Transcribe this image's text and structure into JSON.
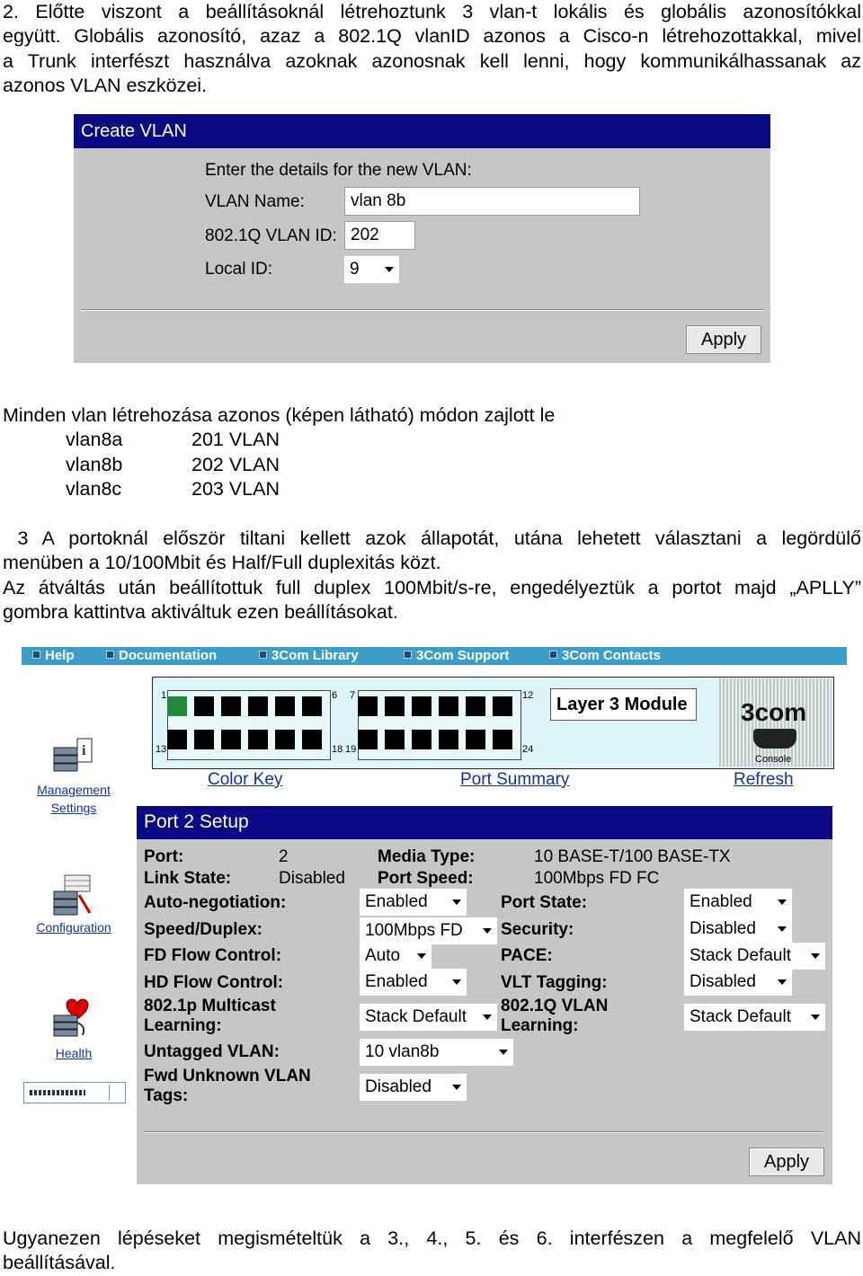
{
  "para1": {
    "lines": [
      "2. Előtte viszont a beállításoknál létrehoztunk 3 vlan-t lokális és globális azonosítókkal",
      "együtt. Globális azonosító, azaz a 802.1Q vlanID azonos a Cisco-n létrehozottakkal, mivel",
      "a Trunk interfészt használva azoknak azonosnak kell lenni, hogy kommunikálhassanak az",
      "azonos VLAN eszközei."
    ]
  },
  "create_vlan": {
    "title": "Create VLAN",
    "prompt": "Enter the details for the new VLAN:",
    "name_label": "VLAN Name:",
    "name_value": "vlan 8b",
    "id_label": "802.1Q VLAN ID:",
    "id_value": "202",
    "local_label": "Local ID:",
    "local_value": "9",
    "apply": "Apply"
  },
  "para2": {
    "intro": "Minden vlan létrehozása azonos (képen látható) módon zajlott le",
    "vlans": [
      {
        "name": "vlan8a",
        "id": "201 VLAN"
      },
      {
        "name": "vlan8b",
        "id": "202 VLAN"
      },
      {
        "name": "vlan8c",
        "id": "203 VLAN"
      }
    ]
  },
  "para3": {
    "lines": [
      " 3 A portoknál először tiltani kellett azok állapotát, utána lehetett választani a legördülő",
      "menüben a 10/100Mbit és Half/Full duplexitás közt.",
      "Az átváltás után beállítottuk full duplex 100Mbit/s-re, engedélyeztük a portot majd „APLLY”",
      "gombra kattintva aktiváltuk ezen beállításokat."
    ]
  },
  "menu": [
    "Help",
    "Documentation",
    "3Com Library",
    "3Com Support",
    "3Com Contacts"
  ],
  "switch": {
    "port_numbers": [
      "1",
      "6",
      "7",
      "12",
      "13",
      "18",
      "19",
      "24"
    ],
    "module_label": "Layer 3 Module",
    "logo": "3com",
    "console": "Console"
  },
  "links": {
    "color_key": "Color Key",
    "port_summary": "Port Summary",
    "refresh": "Refresh"
  },
  "sidebar": [
    {
      "label1": "Management",
      "label2": "Settings"
    },
    {
      "label1": "Configuration",
      "label2": ""
    },
    {
      "label1": "Health",
      "label2": ""
    }
  ],
  "port_setup": {
    "title": "Port 2 Setup",
    "port_label": "Port:",
    "port_value": "2",
    "link_label": "Link State:",
    "link_value": "Disabled",
    "media_label": "Media Type:",
    "media_value": "10 BASE-T/100 BASE-TX",
    "speed_label": "Port Speed:",
    "speed_value": "100Mbps FD FC",
    "autoneg_label": "Auto-negotiation:",
    "autoneg_value": "Enabled",
    "duplex_label": "Speed/Duplex:",
    "duplex_value": "100Mbps FD",
    "fdflow_label": "FD Flow Control:",
    "fdflow_value": "Auto",
    "hdflow_label": "HD Flow Control:",
    "hdflow_value": "Enabled",
    "mcast_label1": "802.1p Multicast",
    "mcast_label2": "Learning:",
    "mcast_value": "Stack Default",
    "untagged_label": "Untagged VLAN:",
    "untagged_value": "10 vlan8b",
    "fwd_label1": "Fwd Unknown VLAN",
    "fwd_label2": "Tags:",
    "fwd_value": "Disabled",
    "portstate_label": "Port State:",
    "portstate_value": "Enabled",
    "security_label": "Security:",
    "security_value": "Disabled",
    "pace_label": "PACE:",
    "pace_value": "Stack Default",
    "vlt_label": "VLT Tagging:",
    "vlt_value": "Disabled",
    "qlearn_label1": "802.1Q VLAN",
    "qlearn_label2": "Learning:",
    "qlearn_value": "Stack Default",
    "apply": "Apply"
  },
  "para4": {
    "line1": "Ugyanezen lépéseket megismételtük a 3., 4., 5. és 6. interfészen a megfelelő VLAN",
    "line2": "beállításával."
  }
}
